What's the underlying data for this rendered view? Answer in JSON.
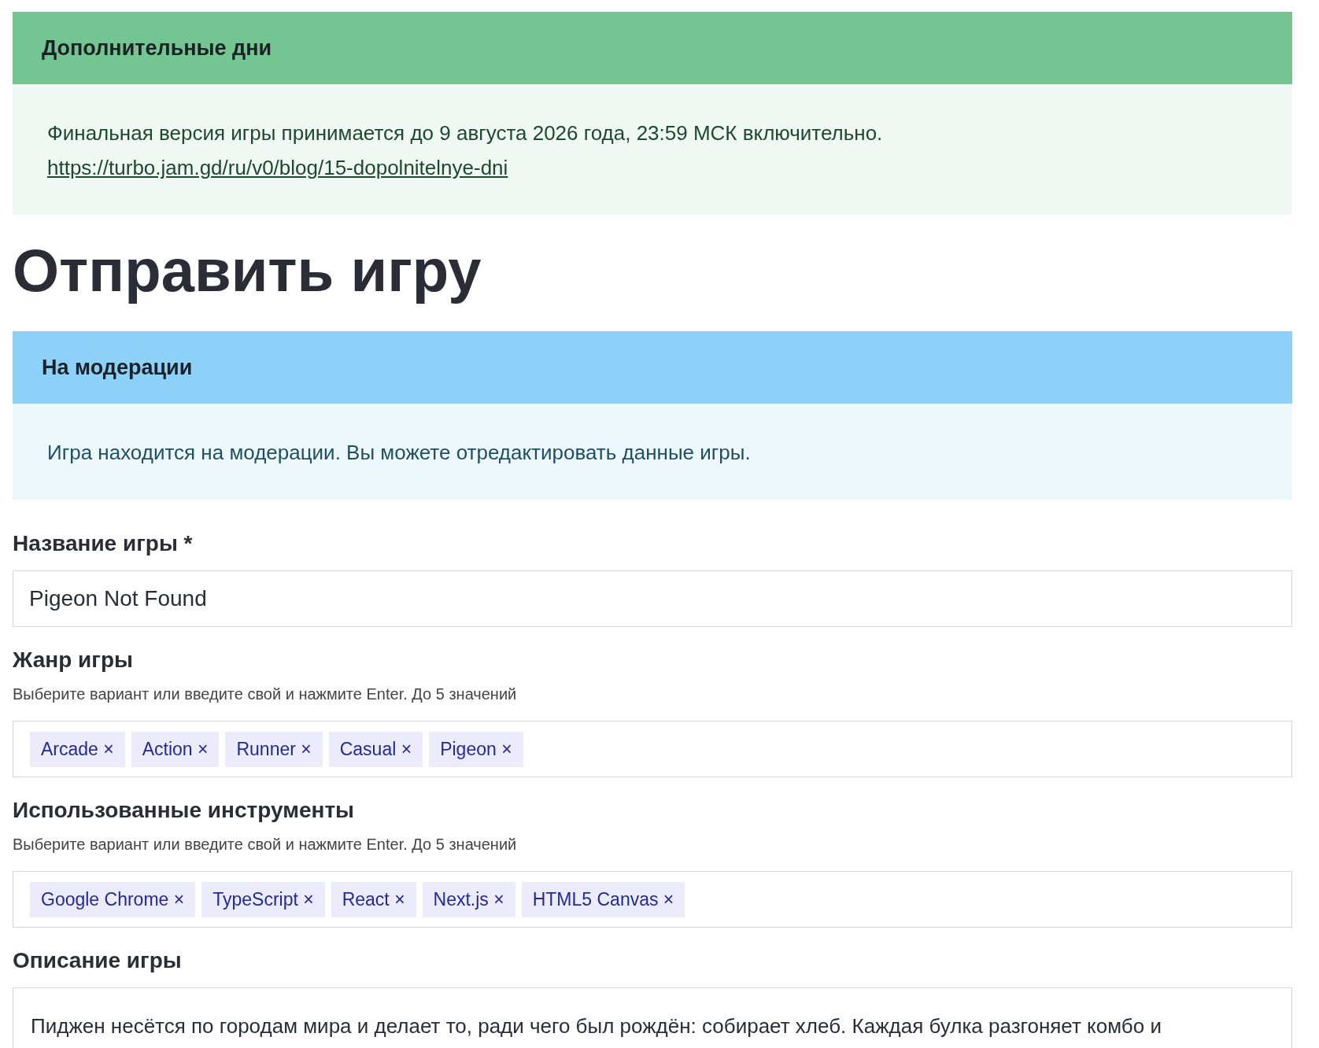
{
  "alerts": [
    {
      "kind": "success",
      "title": "Дополнительные дни",
      "text": "Финальная версия игры принимается до 9 августа 2026 года, 23:59 МСК включительно.",
      "link": "https://turbo.jam.gd/ru/v0/blog/15-dopolnitelnye-dni"
    }
  ],
  "heading": "Отправить игру",
  "status_alert": {
    "kind": "info",
    "title": "На модерации",
    "text": "Игра находится на модерации. Вы можете отредактировать данные игры."
  },
  "fields": [
    {
      "kind": "text",
      "label": "Название игры *",
      "value": "Pigeon Not Found"
    },
    {
      "kind": "tags",
      "label": "Жанр игры",
      "hint": "Выберите вариант или введите свой и нажмите Enter. До 5 значений",
      "tags": [
        "Arcade",
        "Action",
        "Runner",
        "Casual",
        "Pigeon"
      ],
      "remove": "×"
    },
    {
      "kind": "tags",
      "label": "Использованные инструменты",
      "hint": "Выберите вариант или введите свой и нажмите Enter. До 5 значений",
      "tags": [
        "Google Chrome",
        "TypeScript",
        "React",
        "Next.js",
        "HTML5 Canvas"
      ],
      "remove": "×"
    },
    {
      "kind": "textarea",
      "label": "Описание игры",
      "value": "Пиджен несётся по городам мира и делает то, ради чего был рождён: собирает хлеб. Каждая булка разгоняет комбо и"
    }
  ]
}
